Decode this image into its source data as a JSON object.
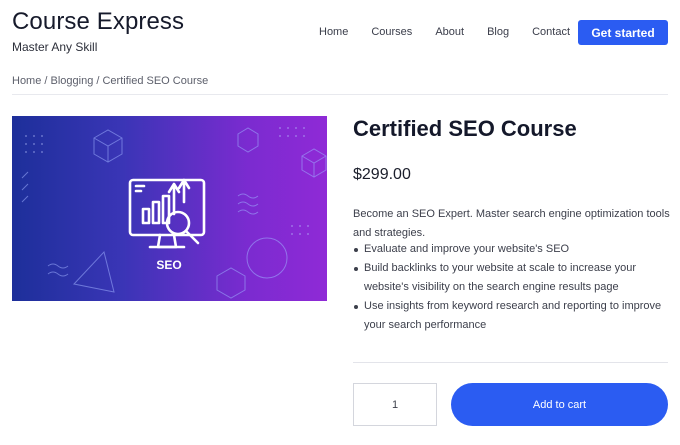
{
  "site": {
    "title": "Course Express",
    "tagline": "Master Any Skill"
  },
  "nav": {
    "items": [
      "Home",
      "Courses",
      "About",
      "Blog",
      "Contact"
    ],
    "cta_label": "Get started"
  },
  "breadcrumb": "Home / Blogging / Certified SEO Course",
  "product": {
    "image_label": "SEO",
    "title": "Certified SEO Course",
    "price": "$299.00",
    "description": "Become an SEO Expert. Master search engine optimization tools and strategies.",
    "bullets": [
      "Evaluate and improve your website's SEO",
      "Build backlinks to your website at scale to increase your website's visibility on the search engine results page",
      "Use insights from keyword research and reporting to improve your search performance"
    ],
    "quantity": "1",
    "add_to_cart_label": "Add to cart"
  },
  "colors": {
    "accent": "#2b5cf2",
    "hero_start": "#1d2f9a",
    "hero_end": "#8f2ad6"
  }
}
